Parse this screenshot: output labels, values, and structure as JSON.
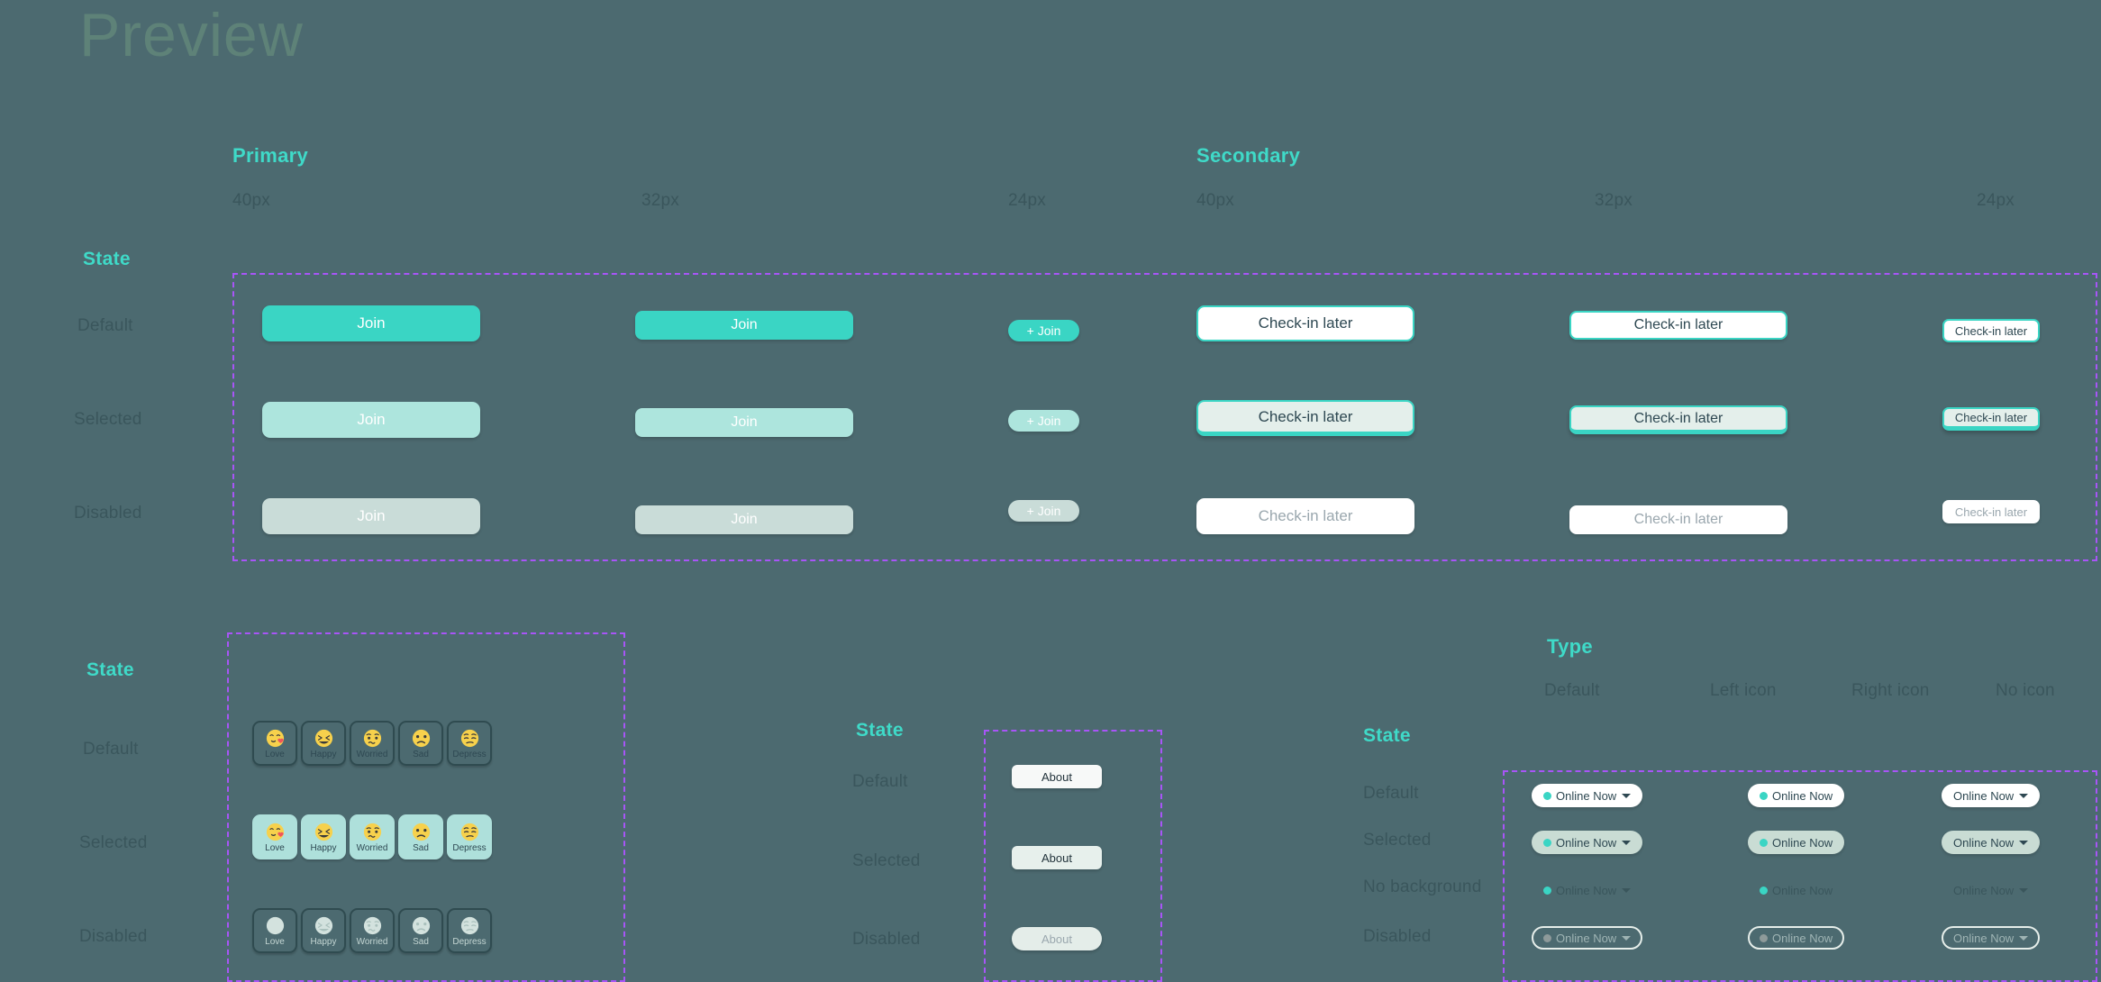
{
  "page": {
    "title": "Preview"
  },
  "buttons_section": {
    "state_heading": "State",
    "groups": [
      {
        "name": "Primary",
        "sizes": [
          "40px",
          "32px",
          "24px"
        ]
      },
      {
        "name": "Secondary",
        "sizes": [
          "40px",
          "32px",
          "24px"
        ]
      }
    ],
    "rows": [
      "Default",
      "Selected",
      "Disabled"
    ],
    "primary_label": "Join",
    "primary_small_label": "+ Join",
    "secondary_label": "Check-in later"
  },
  "emoji_section": {
    "state_heading": "State",
    "rows": [
      "Default",
      "Selected",
      "Disabled"
    ],
    "items": [
      {
        "name": "Love",
        "glyph": "love-emoji"
      },
      {
        "name": "Happy",
        "glyph": "happy-emoji"
      },
      {
        "name": "Worried",
        "glyph": "worried-emoji"
      },
      {
        "name": "Sad",
        "glyph": "sad-emoji"
      },
      {
        "name": "Depress",
        "glyph": "depress-emoji"
      }
    ]
  },
  "about_section": {
    "state_heading": "State",
    "rows": [
      "Default",
      "Selected",
      "Disabled"
    ],
    "label": "About"
  },
  "chips_section": {
    "type_heading": "Type",
    "state_heading": "State",
    "columns": [
      "Default",
      "Left icon",
      "Right icon",
      "No icon"
    ],
    "rows": [
      "Default",
      "Selected",
      "No background",
      "Disabled"
    ],
    "label": "Online Now"
  },
  "colors": {
    "background": "#4C6A70",
    "accent": "#3AD5C4",
    "accent_light": "#ADE5DD",
    "accent_disabled": "#C9DCD8",
    "heading": "#3FDAC8",
    "label": "#3A565C",
    "title": "#5E8278",
    "guide": "#A855F7",
    "emoji_selected": "#AEE0DB",
    "text_dark": "#2E4852",
    "text_muted": "#9AA7AE"
  }
}
